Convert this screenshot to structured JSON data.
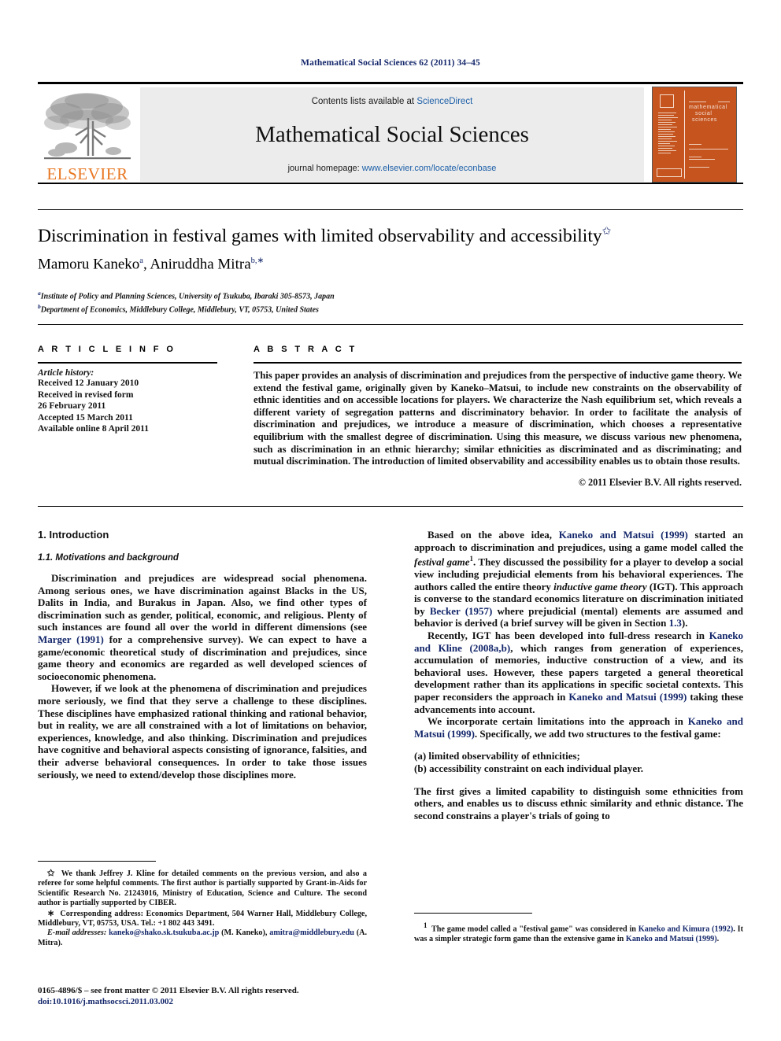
{
  "running_head": "Mathematical Social Sciences 62 (2011) 34–45",
  "masthead": {
    "publisher_name": "ELSEVIER",
    "contents_prefix": "Contents lists available at ",
    "contents_link": "ScienceDirect",
    "journal_name": "Mathematical Social Sciences",
    "homepage_prefix": "journal homepage: ",
    "homepage_link": "www.elsevier.com/locate/econbase",
    "cover_title_line1": "mathematical",
    "cover_title_line2": "social",
    "cover_title_line3": "sciences"
  },
  "article": {
    "title": "Discrimination in festival games with limited observability and accessibility",
    "title_marker": "✩",
    "authors": "Mamoru Kaneko",
    "author1_sup": "a",
    "authors_sep": ", Aniruddha Mitra",
    "author2_sup": "b,∗",
    "affiliation_a_sup": "a",
    "affiliation_a": "Institute of Policy and Planning Sciences, University of Tsukuba, Ibaraki 305-8573, Japan",
    "affiliation_b_sup": "b",
    "affiliation_b": "Department of Economics, Middlebury College, Middlebury, VT, 05753, United States"
  },
  "info": {
    "heading": "A R T I C L E    I N F O",
    "history_label": "Article history:",
    "history": [
      "Received 12 January 2010",
      "Received in revised form",
      "26 February 2011",
      "Accepted 15 March 2011",
      "Available online 8 April 2011"
    ]
  },
  "abstract": {
    "heading": "A B S T R A C T",
    "text": "This paper provides an analysis of discrimination and prejudices from the perspective of inductive game theory. We extend the festival game, originally given by Kaneko–Matsui, to include new constraints on the observability of ethnic identities and on accessible locations for players. We characterize the Nash equilibrium set, which reveals a different variety of segregation patterns and discriminatory behavior. In order to facilitate the analysis of discrimination and prejudices, we introduce a measure of discrimination, which chooses a representative equilibrium with the smallest degree of discrimination. Using this measure, we discuss various new phenomena, such as discrimination in an ethnic hierarchy; similar ethnicities as discriminated and as discriminating; and mutual discrimination. The introduction of limited observability and accessibility enables us to obtain those results.",
    "copyright": "© 2011 Elsevier B.V. All rights reserved."
  },
  "body": {
    "section_number_title": "1.  Introduction",
    "subsection_number_title": "1.1.  Motivations and background",
    "left_p1_a": "Discrimination and prejudices are widespread social phenomena. Among serious ones, we have discrimination against Blacks in the US, Dalits in India, and Burakus in Japan. Also, we find other types of discrimination such as gender, political, economic, and religious. Plenty of such instances are found all over the world in different dimensions (see ",
    "left_p1_ref": "Marger (1991)",
    "left_p1_b": " for a comprehensive survey). We can expect to have a game/economic theoretical study of discrimination and prejudices, since game theory and economics are regarded as well developed sciences of socioeconomic phenomena.",
    "left_p2": "However, if we look at the phenomena of discrimination and prejudices more seriously, we find that they serve a challenge to these disciplines. These disciplines have emphasized rational thinking and rational behavior, but in reality, we are all constrained with a lot of limitations on behavior, experiences, knowledge, and also thinking. Discrimination and prejudices have cognitive and behavioral aspects consisting of ignorance, falsities, and their adverse behavioral consequences. In order to take those issues seriously, we need to extend/develop those disciplines more.",
    "right_p1_a": "Based on the above idea, ",
    "right_p1_ref1": "Kaneko and Matsui (1999)",
    "right_p1_b": " started an approach to discrimination and prejudices, using a game model called the ",
    "right_p1_italic1": "festival game",
    "right_p1_fnmark": "1",
    "right_p1_c": ". They discussed the possibility for a player to develop a social view including prejudicial elements from his behavioral experiences. The authors called the entire theory ",
    "right_p1_italic2": "inductive game theory",
    "right_p1_d": " (IGT). This approach is converse to the standard economics literature on discrimination initiated by ",
    "right_p1_ref2": "Becker (1957)",
    "right_p1_e": " where prejudicial (mental) elements are assumed and behavior is derived (a brief survey will be given in Section ",
    "right_p1_ref3": "1.3",
    "right_p1_f": ").",
    "right_p2_a": "Recently, IGT has been developed into full-dress research in ",
    "right_p2_ref1": "Kaneko and Kline (2008a,b)",
    "right_p2_b": ", which ranges from generation of experiences, accumulation of memories, inductive construction of a view, and its behavioral uses. However, these papers targeted a general theoretical development rather than its applications in specific societal contexts. This paper reconsiders the approach in ",
    "right_p2_ref2": "Kaneko and Matsui (1999)",
    "right_p2_c": " taking these advancements into account.",
    "right_p3_a": "We incorporate certain limitations into the approach in ",
    "right_p3_ref1": "Kaneko and Matsui (1999)",
    "right_p3_b": ". Specifically, we add two structures to the festival game:",
    "list_a": "(a)  limited observability of ethnicities;",
    "list_b": "(b)  accessibility constraint on each individual player.",
    "right_p4": "The first gives a limited capability to distinguish some ethnicities from others, and enables us to discuss ethnic similarity and ethnic distance. The second constrains a player's trials of going to"
  },
  "footnotes": {
    "left_fn_star1_mark": "✩",
    "left_fn_star1": "We thank Jeffrey J. Kline for detailed comments on the previous version, and also a referee for some helpful comments. The first author is partially supported by Grant-in-Aids for Scientific Research No. 21243016, Ministry of Education, Science and Culture. The second author is partially supported by CIBER.",
    "left_fn_star2_mark": "∗",
    "left_fn_star2": "Corresponding address: Economics Department, 504 Warner Hall, Middlebury College, Middlebury, VT, 05753, USA. Tel.: +1 802 443 3491.",
    "email_label": "E-mail addresses:",
    "email1": "kaneko@shako.sk.tsukuba.ac.jp",
    "email1_owner": " (M. Kaneko),",
    "email2": "amitra@middlebury.edu",
    "email2_owner": " (A. Mitra).",
    "right_fn_mark": "1",
    "right_fn_a": "The game model called a \"festival game\" was considered in ",
    "right_fn_ref1": "Kaneko and Kimura (1992)",
    "right_fn_b": ". It was a simpler strategic form game than the extensive game in ",
    "right_fn_ref2": "Kaneko and Matsui (1999)",
    "right_fn_c": "."
  },
  "issn": {
    "line": "0165-4896/$ – see front matter © 2011 Elsevier B.V. All rights reserved.",
    "doi": "doi:10.1016/j.mathsocsci.2011.03.002"
  },
  "colors": {
    "link": "#1c5fa8",
    "reference": "#14276b",
    "elsevier_orange": "#e87722",
    "cover_orange": "#c5541f",
    "band_grey": "#ececec"
  }
}
